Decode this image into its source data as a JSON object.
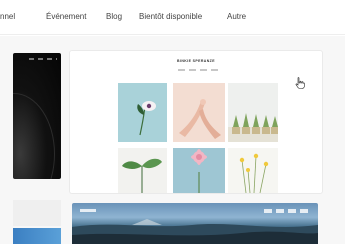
{
  "nav": {
    "items": [
      {
        "label": "nnel"
      },
      {
        "label": "Événement"
      },
      {
        "label": "Blog"
      },
      {
        "label": "Bientôt disponible"
      },
      {
        "label": "Autre"
      }
    ]
  },
  "template_card": {
    "title": "BINKIE SPERANZE"
  },
  "icons": {
    "cursor": "hand-pointer-icon"
  },
  "colors": {
    "nav_text": "#444444",
    "photo_teal": "#a9d2d9",
    "photo_peach": "#f3ddd2",
    "photo_blue": "#9ec6d3"
  }
}
